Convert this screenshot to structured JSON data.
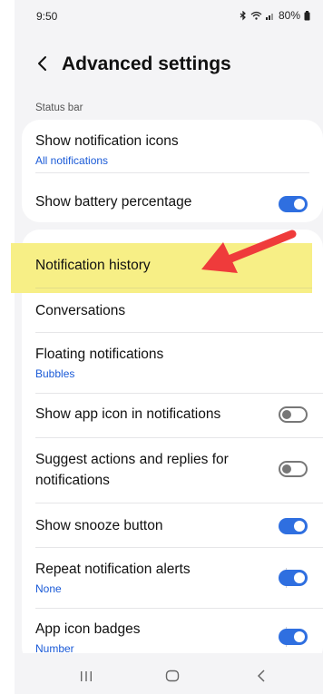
{
  "status_bar": {
    "time": "9:50",
    "battery": "80%"
  },
  "header": {
    "title": "Advanced settings"
  },
  "section": {
    "label": "Status bar"
  },
  "status_card": {
    "show_icons": {
      "title": "Show notification icons",
      "subtitle": "All notifications"
    },
    "battery_pct": {
      "title": "Show battery percentage",
      "enabled": true
    }
  },
  "list": {
    "history": {
      "title": "Notification history"
    },
    "conversations": {
      "title": "Conversations"
    },
    "floating": {
      "title": "Floating notifications",
      "subtitle": "Bubbles"
    },
    "app_icon": {
      "title": "Show app icon in notifications",
      "enabled": false
    },
    "suggest": {
      "title": "Suggest actions and replies for notifications",
      "enabled": false
    },
    "snooze": {
      "title": "Show snooze button",
      "enabled": true
    },
    "repeat": {
      "title": "Repeat notification alerts",
      "subtitle": "None",
      "enabled": true
    },
    "badges": {
      "title": "App icon badges",
      "subtitle": "Number",
      "enabled": true
    }
  },
  "colors": {
    "accent": "#2f6fe0",
    "link": "#1a5ad7",
    "highlight": "#f7ef86",
    "arrow": "#ef3b3b"
  },
  "icons": {
    "back": "chevron-left-icon",
    "recents": "recents-icon",
    "home": "home-icon",
    "nav_back": "nav-back-icon"
  }
}
